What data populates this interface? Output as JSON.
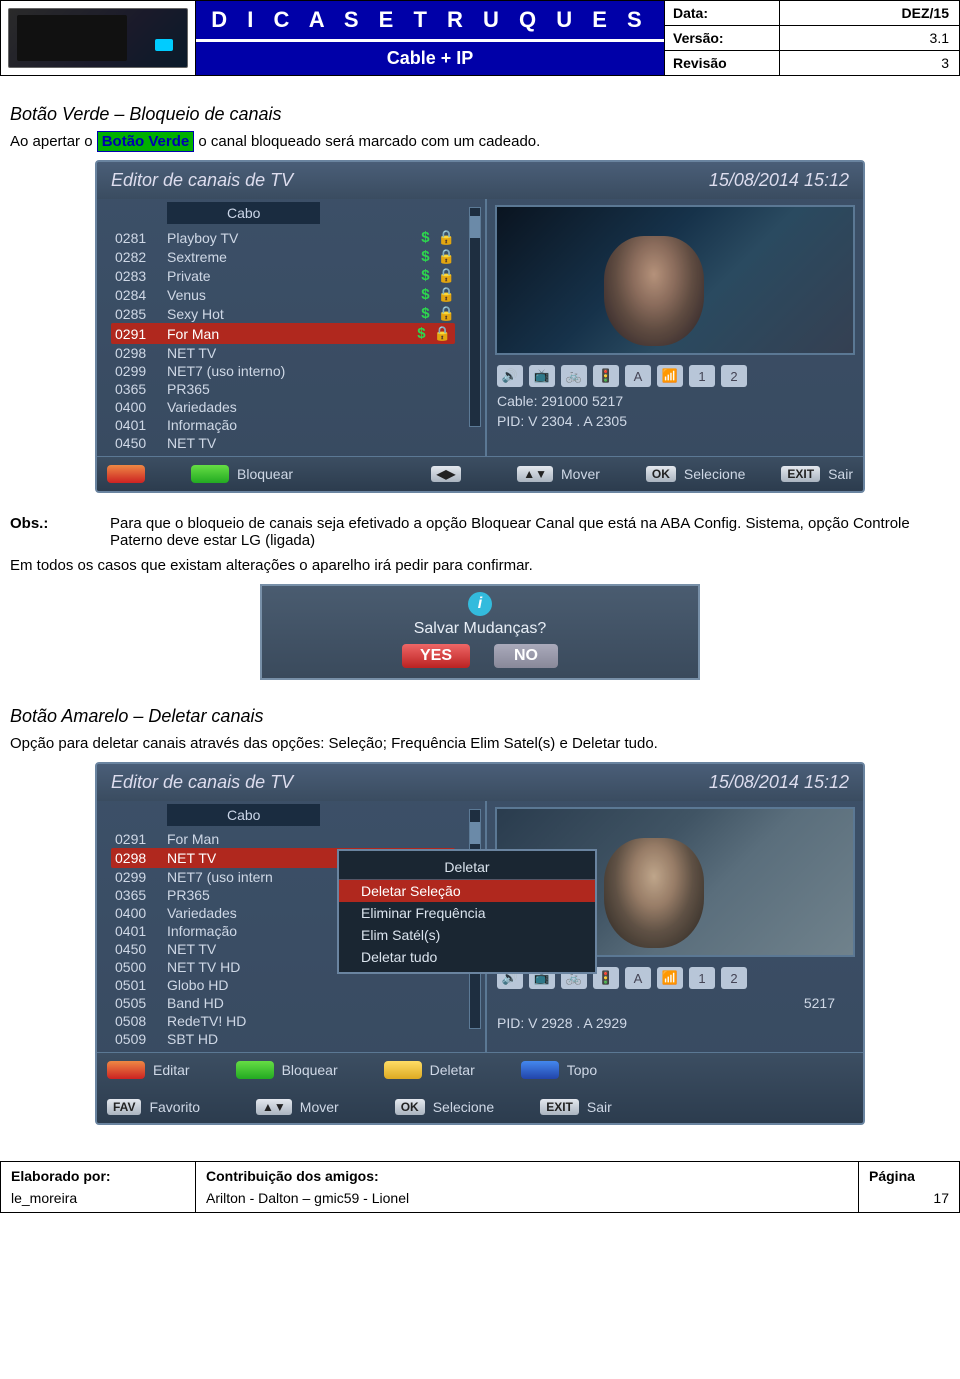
{
  "header": {
    "title": "D I C A S   E   T R U Q U E S",
    "subtitle": "Cable + IP",
    "info": [
      {
        "label": "Data:",
        "value": "DEZ/15"
      },
      {
        "label": "Versão:",
        "value": "3.1"
      },
      {
        "label": "Revisão",
        "value": "3"
      }
    ]
  },
  "section1": {
    "heading": "Botão Verde – Bloqueio de canais",
    "line_pre": "Ao apertar o ",
    "highlight": "Botão Verde",
    "line_post": " o canal bloqueado será marcado com um cadeado."
  },
  "screenshot1": {
    "title": "Editor de canais de TV",
    "datetime": "15/08/2014 15:12",
    "tab": "Cabo",
    "channels": [
      {
        "num": "0281",
        "name": "Playboy TV",
        "paid": true,
        "locked": true
      },
      {
        "num": "0282",
        "name": "Sextreme",
        "paid": true,
        "locked": true
      },
      {
        "num": "0283",
        "name": "Private",
        "paid": true,
        "locked": true
      },
      {
        "num": "0284",
        "name": "Venus",
        "paid": true,
        "locked": true
      },
      {
        "num": "0285",
        "name": "Sexy Hot",
        "paid": true,
        "locked": true
      },
      {
        "num": "0291",
        "name": "For Man",
        "paid": true,
        "locked": true,
        "selected": true
      },
      {
        "num": "0298",
        "name": "NET TV",
        "paid": false,
        "locked": false
      },
      {
        "num": "0299",
        "name": "NET7 (uso interno)",
        "paid": false,
        "locked": false
      },
      {
        "num": "0365",
        "name": "PR365",
        "paid": false,
        "locked": false
      },
      {
        "num": "0400",
        "name": "Variedades",
        "paid": false,
        "locked": false
      },
      {
        "num": "0401",
        "name": "Informação",
        "paid": false,
        "locked": false
      },
      {
        "num": "0450",
        "name": "NET TV",
        "paid": false,
        "locked": false
      }
    ],
    "cable_line": "Cable: 291000  5217",
    "pid_line": "PID: V 2304 . A 2305",
    "footer": {
      "green": "Bloquear",
      "mover": "Mover",
      "ok": "Selecione",
      "exit": "Sair"
    }
  },
  "obs": {
    "label": "Obs.:",
    "text": "Para que o bloqueio de canais seja efetivado a opção Bloquear Canal que está na ABA Config. Sistema, opção Controle Paterno deve estar LG (ligada)",
    "after": "Em todos os casos que existam alterações o aparelho irá pedir para confirmar."
  },
  "dialog": {
    "question": "Salvar Mudanças?",
    "yes": "YES",
    "no": "NO"
  },
  "section2": {
    "heading": "Botão Amarelo – Deletar canais",
    "text": "Opção para deletar canais através das opções: Seleção; Frequência Elim Satel(s) e Deletar tudo."
  },
  "screenshot2": {
    "title": "Editor de canais de TV",
    "datetime": "15/08/2014 15:12",
    "tab": "Cabo",
    "channels": [
      {
        "num": "0291",
        "name": "For Man"
      },
      {
        "num": "0298",
        "name": "NET TV",
        "selected": true
      },
      {
        "num": "0299",
        "name": "NET7 (uso intern"
      },
      {
        "num": "0365",
        "name": "PR365"
      },
      {
        "num": "0400",
        "name": "Variedades"
      },
      {
        "num": "0401",
        "name": "Informação"
      },
      {
        "num": "0450",
        "name": "NET TV"
      },
      {
        "num": "0500",
        "name": "NET TV HD"
      },
      {
        "num": "0501",
        "name": "Globo HD"
      },
      {
        "num": "0505",
        "name": "Band HD"
      },
      {
        "num": "0508",
        "name": "RedeTV! HD"
      },
      {
        "num": "0509",
        "name": "SBT HD"
      }
    ],
    "menu": {
      "title": "Deletar",
      "items": [
        {
          "label": "Deletar Seleção",
          "selected": true
        },
        {
          "label": "Eliminar Frequência"
        },
        {
          "label": "Elim Satél(s)"
        },
        {
          "label": "Deletar tudo"
        }
      ]
    },
    "info_num": "5217",
    "pid_line": "PID: V 2928 . A 2929",
    "footer": {
      "editar": "Editar",
      "bloquear": "Bloquear",
      "deletar": "Deletar",
      "topo": "Topo",
      "favorito": "Favorito",
      "mover": "Mover",
      "ok": "Selecione",
      "exit": "Sair"
    }
  },
  "footer": {
    "col1_label": "Elaborado por:",
    "col1_val": "le_moreira",
    "col2_label": "Contribuição dos amigos:",
    "col2_val": "Arilton - Dalton –  gmic59 - Lionel",
    "col3_label": "Página",
    "col3_val": "17"
  }
}
